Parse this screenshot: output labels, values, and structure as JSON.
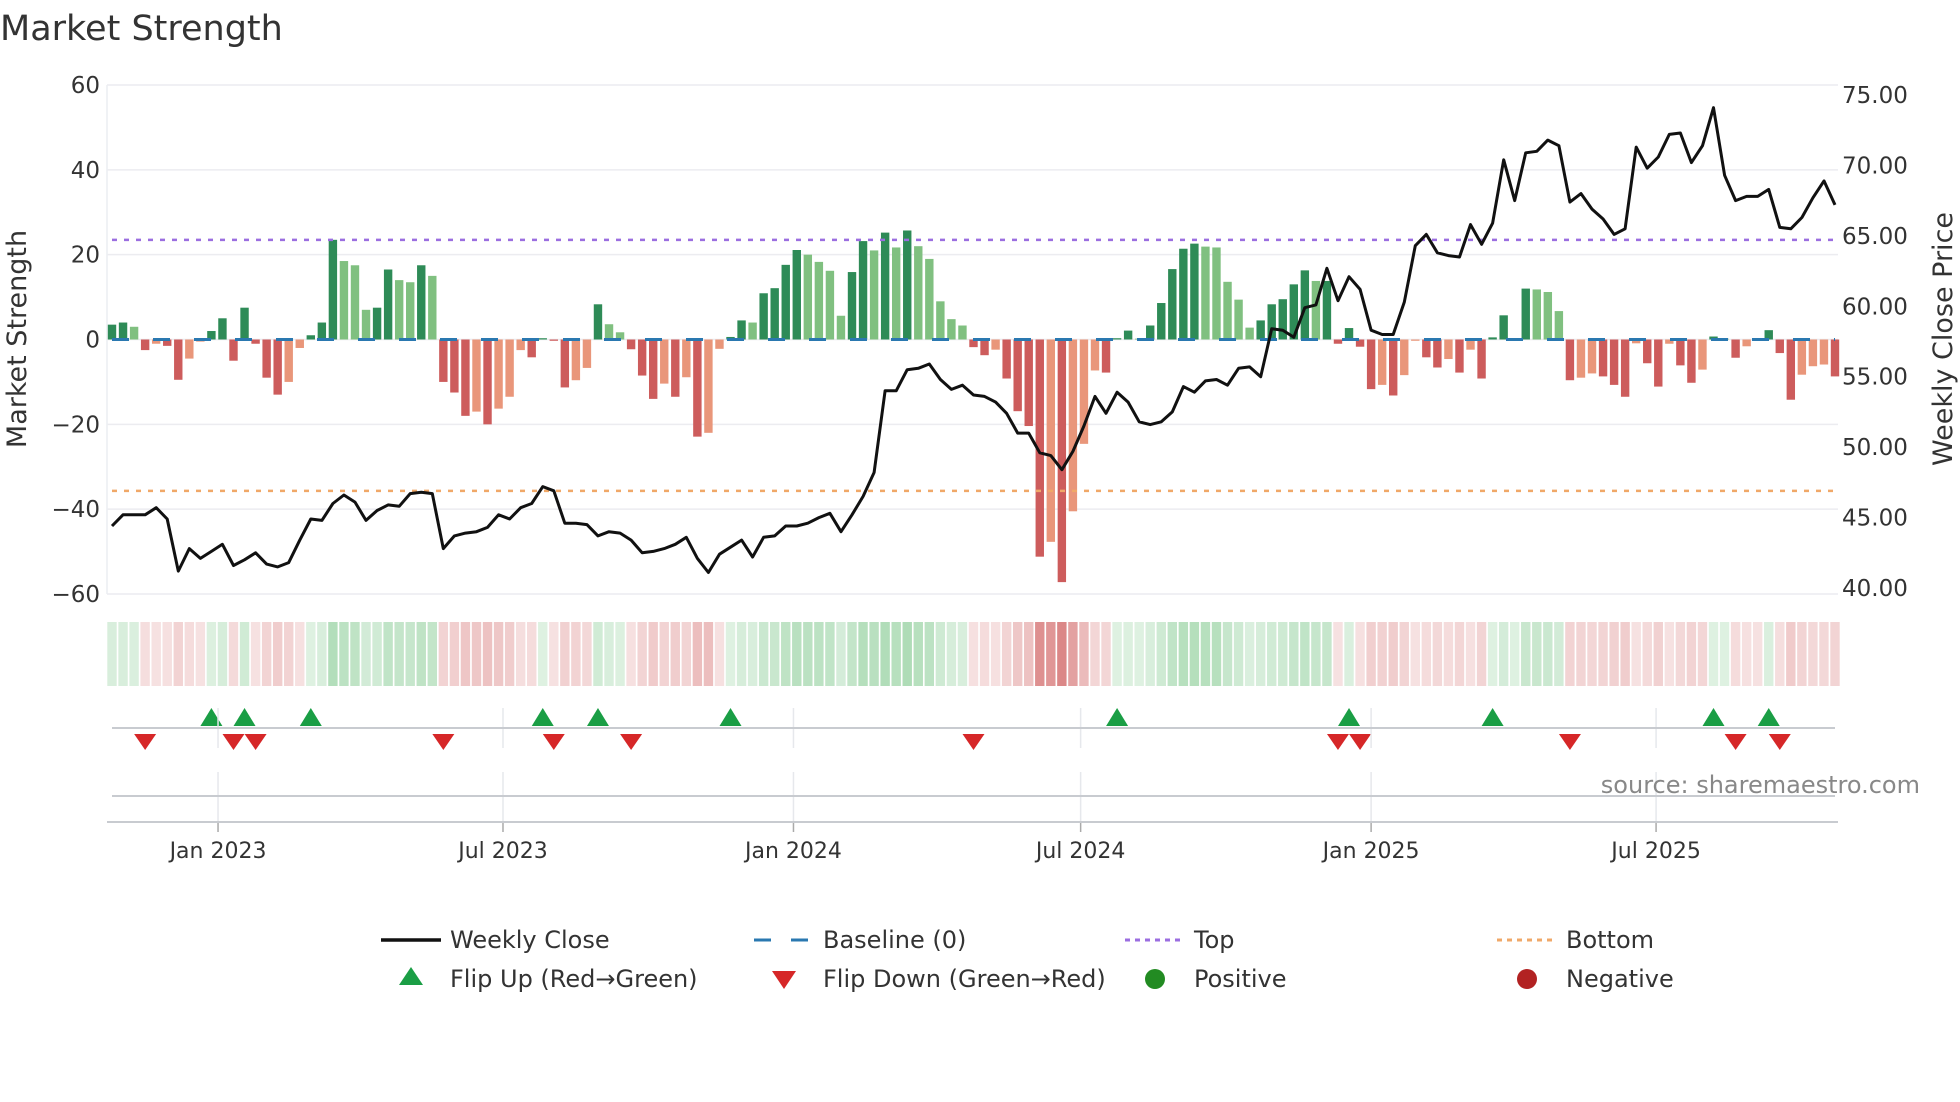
{
  "title": "Market Strength",
  "source": "source: sharemaestro.com",
  "chart_data": {
    "type": "bar+line",
    "title": "Market Strength",
    "ylabel_left": "Market Strength",
    "ylabel_right": "Weekly Close Price",
    "ylim_left": [
      -60,
      60
    ],
    "yticks_left": [
      "60",
      "40",
      "20",
      "0",
      "−20",
      "−40",
      "−60"
    ],
    "ytick_values_left": [
      60,
      40,
      20,
      0,
      -20,
      -40,
      -60
    ],
    "ylim_right": [
      40,
      75
    ],
    "yticks_right": [
      "75.00",
      "70.00",
      "65.00",
      "60.00",
      "55.00",
      "50.00",
      "45.00",
      "40.00"
    ],
    "ytick_values_right": [
      75,
      70,
      65,
      60,
      55,
      50,
      45,
      40
    ],
    "x_start": "2022-10-24",
    "x_interval": "weekly",
    "xticks": [
      {
        "label": "Jan 2023",
        "week": 9.6
      },
      {
        "label": "Jul 2023",
        "week": 35.4
      },
      {
        "label": "Jan 2024",
        "week": 61.7
      },
      {
        "label": "Jul 2024",
        "week": 87.7
      },
      {
        "label": "Jan 2025",
        "week": 114.0
      },
      {
        "label": "Jul 2025",
        "week": 139.8
      }
    ],
    "top_level": 23.5,
    "bottom_level": -35.7,
    "baseline": 0,
    "strength": [
      3.5,
      4,
      3,
      -2.5,
      -1,
      -1.5,
      -9.5,
      -4.5,
      -0.5,
      2,
      5,
      -5,
      7.5,
      -1,
      -9,
      -13,
      -10,
      -2,
      1,
      4,
      23.5,
      18.5,
      17.5,
      7,
      7.5,
      16.5,
      14,
      13.5,
      17.5,
      15,
      -10,
      -12.5,
      -18,
      -17,
      -20,
      -16.3,
      -13.5,
      -2.5,
      -4.2,
      0.3,
      -0.3,
      -11.3,
      -9.6,
      -6.7,
      8.3,
      3.6,
      1.7,
      -2.3,
      -8.5,
      -14,
      -10.4,
      -13.5,
      -8.9,
      -22.9,
      -22,
      -2.2,
      0.6,
      4.5,
      4,
      10.9,
      12.1,
      17.6,
      21.1,
      20,
      18.3,
      16.2,
      5.6,
      15.9,
      23.2,
      21,
      25.2,
      21.7,
      25.7,
      22,
      19,
      9,
      4.8,
      3.3,
      -1.8,
      -3.7,
      -2.4,
      -9.2,
      -16.9,
      -20.4,
      -51.2,
      -47.7,
      -57.2,
      -40.5,
      -24.6,
      -7.3,
      -7.8,
      0.3,
      2.1,
      0.2,
      3.3,
      8.6,
      16.6,
      21.4,
      22.6,
      21.9,
      21.7,
      13.6,
      9.4,
      2.8,
      4.5,
      8.3,
      9.5,
      13,
      16.3,
      13.8,
      13.8,
      -1,
      2.7,
      -1.7,
      -11.7,
      -10.7,
      -13.2,
      -8.4,
      -0.3,
      -4.2,
      -6.6,
      -4.6,
      -7.8,
      -2.4,
      -9.2,
      0.5,
      5.7,
      0.3,
      12,
      11.8,
      11.2,
      6.7,
      -9.6,
      -9,
      -8,
      -8.7,
      -10.7,
      -13.5,
      -0.9,
      -5.6,
      -11.1,
      -1,
      -6.1,
      -10.2,
      -7.1,
      0.7,
      0.2,
      -4.3,
      -1.6,
      -0.2,
      2.2,
      -3.2,
      -14.2,
      -8.3,
      -6.3,
      -5.9,
      -8.7
    ],
    "strength_tone": "DDLRSRRSSDDRDRRRSSDDDLLLDDLLDLRRRSRSSSRDRRSSDLLRRRSRSRSSDDLDDDDLLLLDDLDLDLLLLLRRSRRRRSRSSSRDDLDDDDDLLLLLDDDDDLDRDRRSRSSRRSRSRDDLDLLLRSSRRRSRRSRRSDLRSSDRRSSSR",
    "weekly_close": [
      44.4,
      45.2,
      45.2,
      45.2,
      45.7,
      44.9,
      41.2,
      42.8,
      42.1,
      42.6,
      43.1,
      41.6,
      42.0,
      42.5,
      41.7,
      41.5,
      41.8,
      43.4,
      44.9,
      44.8,
      46.0,
      46.6,
      46.1,
      44.8,
      45.5,
      45.9,
      45.8,
      46.7,
      46.8,
      46.7,
      42.8,
      43.7,
      43.9,
      44.0,
      44.3,
      45.2,
      44.9,
      45.7,
      46.0,
      47.2,
      46.9,
      44.6,
      44.6,
      44.5,
      43.7,
      44.0,
      43.9,
      43.4,
      42.5,
      42.6,
      42.8,
      43.1,
      43.6,
      42.1,
      41.1,
      42.4,
      42.9,
      43.4,
      42.2,
      43.6,
      43.7,
      44.4,
      44.4,
      44.6,
      45.0,
      45.3,
      44.0,
      45.2,
      46.5,
      48.2,
      54.0,
      54.0,
      55.5,
      55.6,
      55.9,
      54.8,
      54.1,
      54.4,
      53.7,
      53.6,
      53.2,
      52.4,
      51.0,
      51.0,
      49.6,
      49.4,
      48.4,
      49.7,
      51.5,
      53.6,
      52.4,
      53.9,
      53.2,
      51.8,
      51.6,
      51.8,
      52.5,
      54.3,
      53.9,
      54.7,
      54.8,
      54.4,
      55.6,
      55.7,
      55.0,
      58.4,
      58.3,
      57.8,
      59.9,
      60.1,
      62.7,
      60.4,
      62.1,
      61.2,
      58.3,
      58.0,
      58.0,
      60.3,
      64.3,
      65.1,
      63.8,
      63.6,
      63.5,
      65.8,
      64.4,
      65.9,
      70.4,
      67.5,
      70.9,
      71.0,
      71.8,
      71.4,
      67.4,
      68.0,
      66.9,
      66.2,
      65.1,
      65.5,
      71.3,
      69.8,
      70.6,
      72.2,
      72.3,
      70.2,
      71.4,
      74.1,
      69.3,
      67.5,
      67.8,
      67.8,
      68.3,
      65.6,
      65.5,
      66.3,
      67.7,
      68.9,
      67.2
    ],
    "flip_up_weeks": [
      9,
      12,
      18,
      39,
      44,
      56,
      91,
      112,
      125,
      145,
      150
    ],
    "flip_down_weeks": [
      3,
      11,
      13,
      30,
      40,
      47,
      78,
      111,
      113,
      132,
      147,
      151
    ],
    "legend": [
      {
        "label": "Weekly Close",
        "kind": "line"
      },
      {
        "label": "Baseline (0)",
        "kind": "dashed"
      },
      {
        "label": "Top",
        "kind": "dotted-purple"
      },
      {
        "label": "Bottom",
        "kind": "dotted-orange"
      },
      {
        "label": "Flip Up (Red→Green)",
        "kind": "triangle-up"
      },
      {
        "label": "Flip Down (Green→Red)",
        "kind": "triangle-down"
      },
      {
        "label": "Positive",
        "kind": "dot-green"
      },
      {
        "label": "Negative",
        "kind": "dot-red"
      }
    ],
    "legend_position": "bottom-center",
    "grid": true
  },
  "colors": {
    "strong_pos": "#2e8b57",
    "weak_pos": "#80c080",
    "strong_neg": "#cd5c5c",
    "weak_neg": "#e9967a",
    "line": "#111111",
    "baseline": "#2a78b0",
    "top": "#9b6ee0",
    "bottom": "#f0a868",
    "flip_up": "#1a9e45",
    "flip_down": "#d62728",
    "positive": "#228b22",
    "negative": "#b22222"
  }
}
